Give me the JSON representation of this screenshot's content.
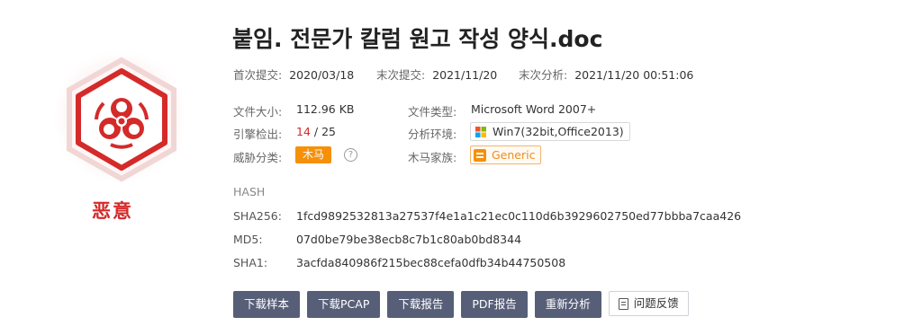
{
  "verdict": {
    "label": "恶意",
    "color": "#d42a2a",
    "icon": "biohazard-icon"
  },
  "file": {
    "title": "붙임. 전문가 칼럼 원고 작성 양식.doc"
  },
  "meta": {
    "first_submit_label": "首次提交:",
    "first_submit_value": "2020/03/18",
    "last_submit_label": "末次提交:",
    "last_submit_value": "2021/11/20",
    "last_analysis_label": "末次分析:",
    "last_analysis_value": "2021/11/20 00:51:06"
  },
  "details": {
    "size_label": "文件大小:",
    "size_value": "112.96 KB",
    "type_label": "文件类型:",
    "type_value": "Microsoft Word 2007+",
    "engines_label": "引擎检出:",
    "engines_detected": "14",
    "engines_sep": " / ",
    "engines_total": "25",
    "env_label": "分析环境:",
    "env_value": "Win7(32bit,Office2013)",
    "threat_label": "威胁分类:",
    "threat_value": "木马",
    "family_label": "木马家族:",
    "family_value": "Generic",
    "help_glyph": "?"
  },
  "hash": {
    "heading": "HASH",
    "sha256_label": "SHA256:",
    "sha256_value": "1fcd9892532813a27537f4e1a1c21ec0c110d6b3929602750ed77bbba7caa426",
    "md5_label": "MD5:",
    "md5_value": "07d0be79be38ecb8c7b1c80ab0bd8344",
    "sha1_label": "SHA1:",
    "sha1_value": "3acfda840986f215bec88cefa0dfb34b44750508"
  },
  "actions": {
    "download_sample": "下载样本",
    "download_pcap": "下载PCAP",
    "download_report": "下载报告",
    "pdf_report": "PDF报告",
    "reanalyze": "重新分析",
    "feedback": "问题反馈"
  },
  "colors": {
    "accent_red": "#d42a2a",
    "button_bg": "#575f78",
    "tag_orange": "#f5900b"
  }
}
